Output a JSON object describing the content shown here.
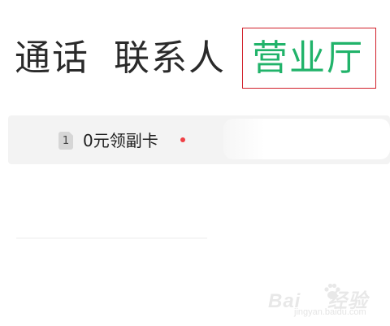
{
  "tabs": {
    "calls": "通话",
    "contacts": "联系人",
    "hall": "营业厅"
  },
  "card": {
    "sim_number": "1",
    "label": "0元领副卡"
  },
  "watermark": {
    "text_left": "Bai",
    "text_right": "经验",
    "url": "jingyan.baidu.com"
  },
  "colors": {
    "active_tab": "#21b36a",
    "highlight_box": "#d11f2a",
    "notification_dot": "#ef3f45"
  }
}
